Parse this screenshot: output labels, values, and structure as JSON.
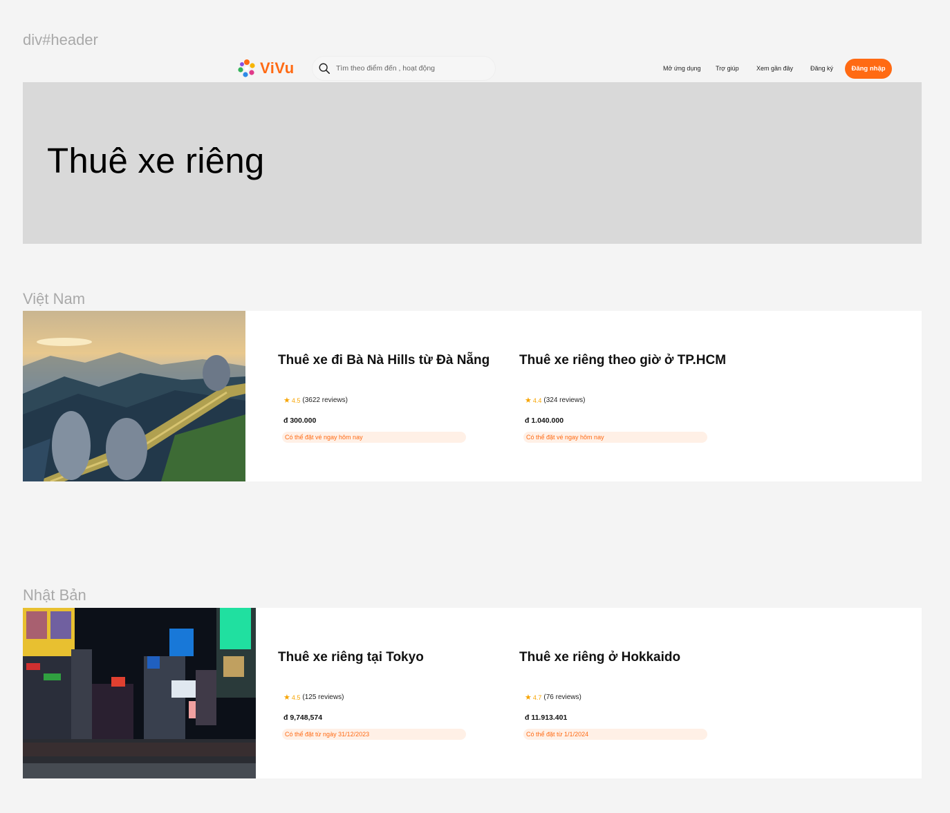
{
  "header_label": "div#header",
  "header": {
    "logo_text": "ViVu",
    "search_placeholder": "Tìm theo điểm đến , hoạt động",
    "nav": {
      "open_app": "Mở ứng dụng",
      "help": "Trợ giúp",
      "recently_viewed": "Xem gần đây",
      "signup": "Đăng ký",
      "login": "Đăng nhập"
    }
  },
  "hero": {
    "title": "Thuê xe riêng"
  },
  "sections": [
    {
      "label": "Việt Nam",
      "products": [
        {
          "title": "Thuê xe đi Bà Nà Hills từ Đà Nẵng",
          "rating": "4.5",
          "reviews": "(3622 reviews)",
          "price": "đ 300.000",
          "availability": "Có thể đặt vé ngay hôm nay"
        },
        {
          "title": "Thuê xe riêng theo giờ ở TP.HCM",
          "rating": "4.4",
          "reviews": "(324 reviews)",
          "price": "đ 1.040.000",
          "availability": "Có thể đặt vé ngay hôm nay"
        }
      ]
    },
    {
      "label": "Nhật Bản",
      "products": [
        {
          "title": "Thuê xe riêng tại Tokyo",
          "rating": "4.5",
          "reviews": "(125 reviews)",
          "price": "đ 9,748,574",
          "availability": "Có thể đặt từ ngày 31/12/2023"
        },
        {
          "title": "Thuê xe riêng ở Hokkaido",
          "rating": "4.7",
          "reviews": "(76 reviews)",
          "price": "đ 11.913.401",
          "availability": "Có thể đặt từ 1/1/2024"
        }
      ]
    }
  ],
  "icons": {
    "search": "search-icon",
    "star": "star-icon",
    "logo": "pinwheel-logo-icon"
  },
  "colors": {
    "brand": "#ff6a13",
    "star": "#f7a400",
    "hero_bg": "#d9d9d9",
    "page_bg": "#f4f4f4"
  }
}
